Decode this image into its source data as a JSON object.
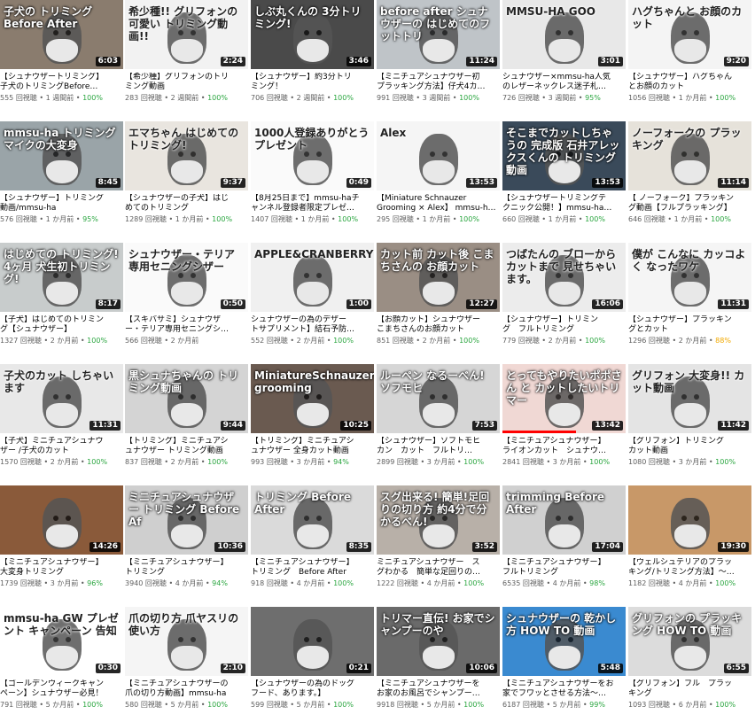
{
  "cards": [
    {
      "overlay": "子犬の トリミング Before After",
      "duration": "6:03",
      "title": "【シュナウザートリミング】\n子犬のトリミングBefore…",
      "views": "555 回視聴",
      "age": "1 週間前",
      "rating": "100%",
      "bg": "#8a7c6e",
      "progress": 0.0
    },
    {
      "overlay": "希少種!! グリフォンの 可愛い トリミング動画!!",
      "duration": "2:24",
      "title": "【希少種】グリフォンのトリ\nミング動画",
      "views": "283 回視聴",
      "age": "2 週間前",
      "rating": "100%",
      "bg": "#f2f2f2",
      "progress": 0.0
    },
    {
      "overlay": "しぶ丸くんの 3分トリミング!",
      "duration": "3:46",
      "title": "【シュナウザー】約3分トリ\nミング！",
      "views": "706 回視聴",
      "age": "2 週間前",
      "rating": "100%",
      "bg": "#4a4a4a",
      "progress": 0.0
    },
    {
      "overlay": "before after シュナウザーの はじめてのフットトリ",
      "duration": "11:24",
      "title": "【ミニチュアシュナウザー初\nプラッキング方法】仔犬4カ…",
      "views": "991 回視聴",
      "age": "3 週間前",
      "rating": "100%",
      "bg": "#bfc4c8",
      "progress": 0.0
    },
    {
      "overlay": "MMSU-HA GOO",
      "duration": "3:01",
      "title": "シュナウザー×mmsu-ha人気\nのレザーネックレス迷子札…",
      "views": "726 回視聴",
      "age": "3 週間前",
      "rating": "95%",
      "bg": "#e8e8e8",
      "progress": 0.0
    },
    {
      "overlay": "ハグちゃんと お顔のカット",
      "duration": "9:20",
      "title": "【シュナウザー】ハグちゃん\nとお顔のカット",
      "views": "1056 回視聴",
      "age": "1 か月前",
      "rating": "100%",
      "bg": "#f4f4f4",
      "progress": 0.0
    },
    {
      "overlay": "mmsu-ha トリミング マイクの大変身",
      "duration": "8:45",
      "title": "【シュナウザー】トリミング\n動画/mmsu-ha",
      "views": "576 回視聴",
      "age": "1 か月前",
      "rating": "95%",
      "bg": "#9aa4a8",
      "progress": 0.0
    },
    {
      "overlay": "エマちゃん はじめてのトリミング!",
      "duration": "9:37",
      "title": "【シュナウザーの子犬】はじ\nめてのトリミング",
      "views": "1289 回視聴",
      "age": "1 か月前",
      "rating": "100%",
      "bg": "#e9e5df",
      "progress": 0.0
    },
    {
      "overlay": "1000人登録ありがとうプレゼント",
      "duration": "0:49",
      "title": "【8月25日まで】mmsu-haチ\nャンネル登録者限定プレゼ…",
      "views": "1407 回視聴",
      "age": "1 か月前",
      "rating": "100%",
      "bg": "#fafafa",
      "progress": 0.0
    },
    {
      "overlay": "Alex",
      "duration": "13:53",
      "title": "【Miniature Schnauzer\nGrooming × Alex】 mmsu-h…",
      "views": "295 回視聴",
      "age": "1 か月前",
      "rating": "100%",
      "bg": "#f5f5f5",
      "progress": 0.0
    },
    {
      "overlay": "そこまでカットしちゃうの 完成版 石井アレックスくんの トリミング動画",
      "duration": "13:53",
      "title": "【シュナウザートリミングテ\nクニック公開！】mmsu-ha…",
      "views": "660 回視聴",
      "age": "1 か月前",
      "rating": "100%",
      "bg": "#3a4a5a",
      "progress": 0.0
    },
    {
      "overlay": "ノーフォークの プラッキング",
      "duration": "11:14",
      "title": "【 ノーフォーク】プラッキン\nグ動画【フルプラッキング】",
      "views": "646 回視聴",
      "age": "1 か月前",
      "rating": "100%",
      "bg": "#e6e2da",
      "progress": 0.0
    },
    {
      "overlay": "はじめての トリミング! 4ヶ月 犬生初トリミング!",
      "duration": "8:17",
      "title": "【子犬】はじめてのトリミン\nグ【シュナウザー】",
      "views": "1327 回視聴",
      "age": "2 か月前",
      "rating": "100%",
      "bg": "#c8cccc",
      "progress": 0.0
    },
    {
      "overlay": "シュナウザー・テリア専用セニングシザー",
      "duration": "0:50",
      "title": "【スキバサミ】シュナウザ\nー・テリア専用セニングシ…",
      "views": "566 回視聴",
      "age": "2 か月前",
      "rating": "",
      "bg": "#fafafa",
      "progress": 0.0
    },
    {
      "overlay": "APPLE&CRANBERRY",
      "duration": "1:00",
      "title": "シュナウザーの為のデザー\nトサプリメント】結石予防…",
      "views": "552 回視聴",
      "age": "2 か月前",
      "rating": "100%",
      "bg": "#f0f0f0",
      "progress": 0.0
    },
    {
      "overlay": "カット前 カット後 こまちさんの お顔カット",
      "duration": "12:27",
      "title": "【お顔カット】シュナウザー\nこまちさんのお顔カット",
      "views": "851 回視聴",
      "age": "2 か月前",
      "rating": "100%",
      "bg": "#9a8e84",
      "progress": 0.0
    },
    {
      "overlay": "つばたんの ブローからカットまで 見せちゃいます。",
      "duration": "16:06",
      "title": "【シュナウザー】トリミン\nグ　フルトリミング",
      "views": "779 回視聴",
      "age": "2 か月前",
      "rating": "100%",
      "bg": "#ececec",
      "progress": 0.0
    },
    {
      "overlay": "僕が こんなに カッコよく なったワケ",
      "duration": "11:31",
      "title": "【シュナウザー】プラッキン\nグとカット",
      "views": "1296 回視聴",
      "age": "2 か月前",
      "rating": "88%",
      "bg": "#f5f5f5",
      "progress": 0.0
    },
    {
      "overlay": "子犬のカット しちゃいます",
      "duration": "11:31",
      "title": "【子犬】ミニチュアシュナウ\nザー /子犬のカット",
      "views": "1570 回視聴",
      "age": "2 か月前",
      "rating": "100%",
      "bg": "#e8e8e8",
      "progress": 0.0
    },
    {
      "overlay": "黒シュナちゃんの トリミング動画",
      "duration": "9:44",
      "title": "【トリミング】ミニチュアシ\nュナウザー トリミング動画",
      "views": "837 回視聴",
      "age": "2 か月前",
      "rating": "100%",
      "bg": "#d4d4d4",
      "progress": 0.0
    },
    {
      "overlay": "MiniatureSchnauzer grooming",
      "duration": "10:25",
      "title": "【トリミング】ミニチュアシ\nュナウザー 全身カット動画",
      "views": "993 回視聴",
      "age": "3 か月前",
      "rating": "94%",
      "bg": "#6a5a50",
      "progress": 0.0
    },
    {
      "overlay": "ルーペン なるーべん! ソフモヒ",
      "duration": "7:53",
      "title": "【シュナウザー】ソフトモヒ\nカン　カット　フルトリ…",
      "views": "2899 回視聴",
      "age": "3 か月前",
      "rating": "100%",
      "bg": "#d6d6d6",
      "progress": 0.0
    },
    {
      "overlay": "とってもやりたいポポさん と カットしたいトリマー",
      "duration": "13:42",
      "title": "【ミニチュアシュナウザー】\nライオンカット　シュナウ…",
      "views": "2841 回視聴",
      "age": "3 か月前",
      "rating": "100%",
      "bg": "#f0d8d4",
      "progress": 0.6
    },
    {
      "overlay": "グリフォン 大変身!! カット動画",
      "duration": "11:42",
      "title": "【グリフォン】トリミング\nカット動画",
      "views": "1080 回視聴",
      "age": "3 か月前",
      "rating": "100%",
      "bg": "#e4e4e4",
      "progress": 0.0
    },
    {
      "overlay": "",
      "duration": "14:26",
      "title": "【ミニチュアシュナウザー】\n大変身トリミング",
      "views": "1739 回視聴",
      "age": "3 か月前",
      "rating": "96%",
      "bg": "#8a5a3a",
      "progress": 0.0
    },
    {
      "overlay": "ミニチュアシュナウザー トリミング Before Af",
      "duration": "10:36",
      "title": "【ミニチュアシュナウザー】\nトリミング",
      "views": "3940 回視聴",
      "age": "4 か月前",
      "rating": "94%",
      "bg": "#cfcfcf",
      "progress": 0.0
    },
    {
      "overlay": "トリミング Before After",
      "duration": "8:35",
      "title": "【ミニチュアシュナウザー】\nトリミング　Before After",
      "views": "918 回視聴",
      "age": "4 か月前",
      "rating": "100%",
      "bg": "#dadada",
      "progress": 0.0
    },
    {
      "overlay": "スグ出来る! 簡単!足回りの切り方 約4分で分かるべん!",
      "duration": "3:52",
      "title": "ミニチュアシュナウザー　ス\nグわかる　簡単な足回りの…",
      "views": "1222 回視聴",
      "age": "4 か月前",
      "rating": "100%",
      "bg": "#b8b0a8",
      "progress": 0.0
    },
    {
      "overlay": "trimming Before After",
      "duration": "17:04",
      "title": "【ミニチュアシュナウザー】\nフルトリミング",
      "views": "6535 回視聴",
      "age": "4 か月前",
      "rating": "98%",
      "bg": "#d0d0d0",
      "progress": 0.0
    },
    {
      "overlay": "",
      "duration": "19:30",
      "title": "【ウェルシュテリアのプラッ\nキング/トリミング方法】〜…",
      "views": "1182 回視聴",
      "age": "4 か月前",
      "rating": "100%",
      "bg": "#c89868",
      "progress": 0.0
    },
    {
      "overlay": "mmsu-ha GW プレゼント キャンペーン 告知",
      "duration": "0:30",
      "title": "【ゴールデンウィークキャン\nペーン】シュナウザー必見！",
      "views": "791 回視聴",
      "age": "5 か月前",
      "rating": "100%",
      "bg": "#ffffff",
      "progress": 0.0
    },
    {
      "overlay": "爪の切り方 爪ヤスリの使い方",
      "duration": "2:10",
      "title": "【ミニチュアシュナウザーの\n爪の切り方動画】mmsu-ha",
      "views": "580 回視聴",
      "age": "5 か月前",
      "rating": "100%",
      "bg": "#f5f5f5",
      "progress": 0.0
    },
    {
      "overlay": "",
      "duration": "0:21",
      "title": "【シュナウザーの為のドッグ\nフード、あります。】",
      "views": "599 回視聴",
      "age": "5 か月前",
      "rating": "100%",
      "bg": "#6e6e6e",
      "progress": 0.0
    },
    {
      "overlay": "トリマー直伝! お家でシャンプーのや",
      "duration": "10:06",
      "title": "【ミニチュアシュナウザーを\nお家のお風呂でシャンプー…",
      "views": "9918 回視聴",
      "age": "5 か月前",
      "rating": "100%",
      "bg": "#6a6a6a",
      "progress": 0.0
    },
    {
      "overlay": "シュナウザーの 乾かし方 HOW TO 動画",
      "duration": "5:48",
      "title": "【ミニチュアシュナウザーをお\n家でフワッとさせる方法〜…",
      "views": "6187 回視聴",
      "age": "5 か月前",
      "rating": "99%",
      "bg": "#3a8ad0",
      "progress": 0.0
    },
    {
      "overlay": "グリフォンの プラッキング HOW TO 動画",
      "duration": "6:55",
      "title": "【グリフォン】フル　プラッ\nキング",
      "views": "1093 回視聴",
      "age": "6 か月前",
      "rating": "100%",
      "bg": "#dcdcdc",
      "progress": 0.0
    }
  ]
}
